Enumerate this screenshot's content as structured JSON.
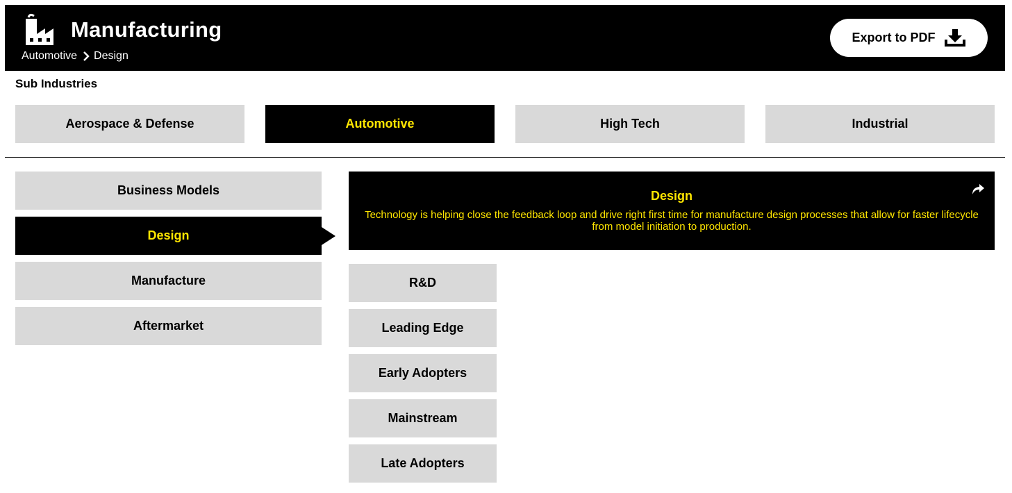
{
  "header": {
    "title": "Manufacturing",
    "logo_icon": "factory-icon",
    "breadcrumb": [
      "Automotive",
      "Design"
    ],
    "export_label": "Export to PDF",
    "export_icon": "download-icon"
  },
  "sub_industries": {
    "label": "Sub Industries",
    "tabs": [
      {
        "label": "Aerospace & Defense",
        "active": false
      },
      {
        "label": "Automotive",
        "active": true
      },
      {
        "label": "High Tech",
        "active": false
      },
      {
        "label": "Industrial",
        "active": false
      }
    ]
  },
  "categories": [
    {
      "label": "Business Models",
      "active": false
    },
    {
      "label": "Design",
      "active": true
    },
    {
      "label": "Manufacture",
      "active": false
    },
    {
      "label": "Aftermarket",
      "active": false
    }
  ],
  "detail": {
    "title": "Design",
    "description": "Technology is helping close the feedback loop and drive right first time for manufacture design processes that allow for faster lifecycle from model initiation to production.",
    "share_icon": "share-icon"
  },
  "stages": [
    {
      "label": "R&D"
    },
    {
      "label": "Leading Edge"
    },
    {
      "label": "Early Adopters"
    },
    {
      "label": "Mainstream"
    },
    {
      "label": "Late Adopters"
    }
  ],
  "colors": {
    "background": "#ffffff",
    "header_bg": "#000000",
    "accent": "#ffe600",
    "tile_bg": "#d9d9d9"
  }
}
